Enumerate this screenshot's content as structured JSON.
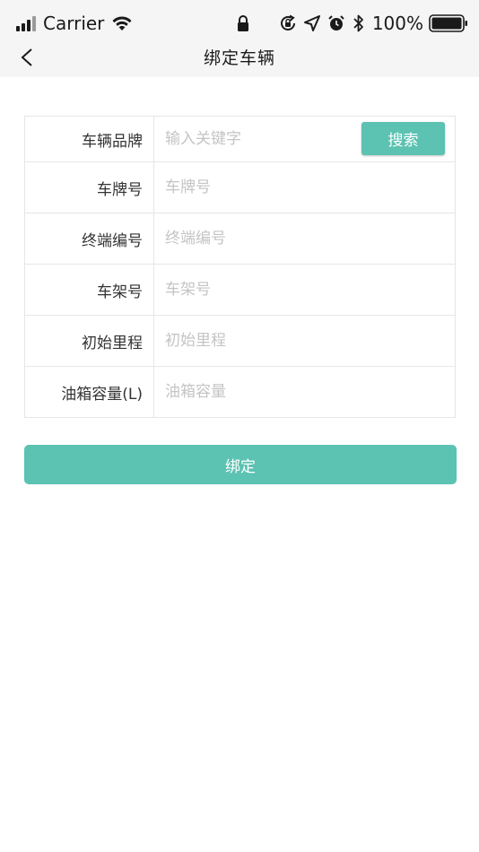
{
  "status_bar": {
    "carrier": "Carrier",
    "battery": "100%",
    "icons": [
      "signal-icon",
      "wifi-icon",
      "lock-icon",
      "rotation-lock-icon",
      "location-icon",
      "alarm-icon",
      "bluetooth-icon",
      "battery-icon"
    ]
  },
  "nav": {
    "title": "绑定车辆",
    "back_icon": "chevron-left-icon"
  },
  "form": {
    "brand": {
      "label": "车辆品牌",
      "placeholder": "输入关键字",
      "button": "搜索"
    },
    "plate": {
      "label": "车牌号",
      "placeholder": "车牌号"
    },
    "terminal": {
      "label": "终端编号",
      "placeholder": "终端编号"
    },
    "frame": {
      "label": "车架号",
      "placeholder": "车架号"
    },
    "mileage": {
      "label": "初始里程",
      "placeholder": "初始里程"
    },
    "tank": {
      "label": "油箱容量(L)",
      "placeholder": "油箱容量"
    }
  },
  "bind_button": "绑定",
  "colors": {
    "accent": "#5cc2b2",
    "header_bg": "#f5f5f5",
    "border": "#e6e6e6",
    "placeholder": "#c4c4c4"
  }
}
